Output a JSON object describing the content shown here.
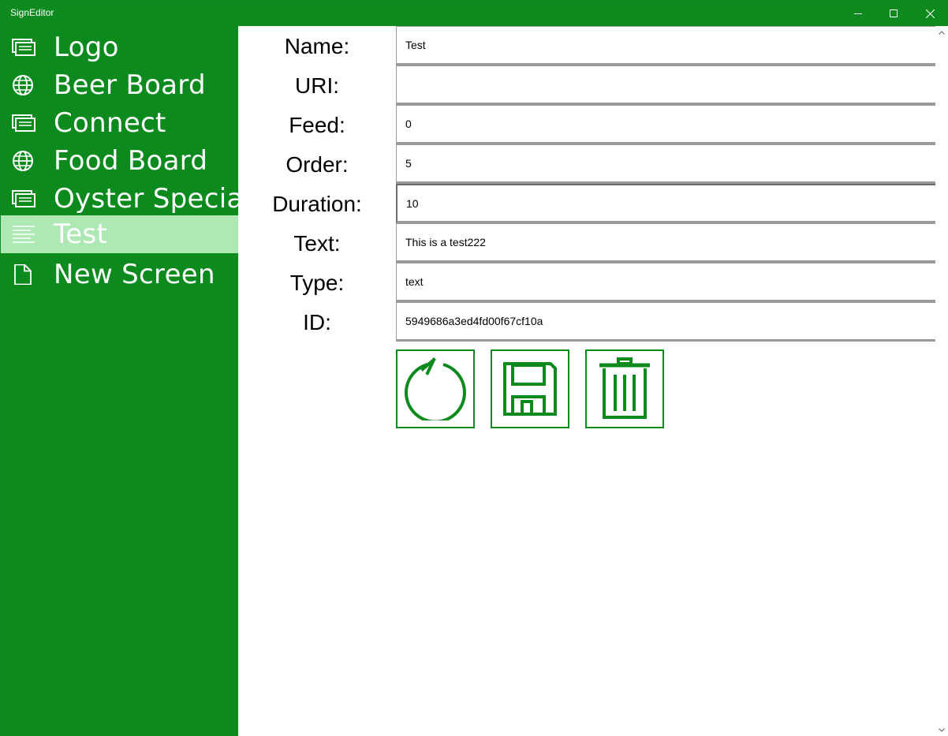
{
  "window": {
    "title": "SignEditor",
    "accent_color": "#0c8a1e",
    "selected_color": "#aee8b5"
  },
  "sidebar": {
    "items": [
      {
        "label": "Logo",
        "icon": "slides-icon",
        "selected": false
      },
      {
        "label": "Beer Board",
        "icon": "globe-icon",
        "selected": false
      },
      {
        "label": "Connect",
        "icon": "slides-icon",
        "selected": false
      },
      {
        "label": "Food Board",
        "icon": "globe-icon",
        "selected": false
      },
      {
        "label": "Oyster Special",
        "icon": "slides-icon",
        "selected": false
      },
      {
        "label": "Test",
        "icon": "text-lines-icon",
        "selected": true
      },
      {
        "label": "New Screen",
        "icon": "document-icon",
        "selected": false
      }
    ]
  },
  "form": {
    "name": {
      "label": "Name:",
      "value": "Test"
    },
    "uri": {
      "label": "URI:",
      "value": ""
    },
    "feed": {
      "label": "Feed:",
      "value": "0"
    },
    "order": {
      "label": "Order:",
      "value": "5"
    },
    "duration": {
      "label": "Duration:",
      "value": "10"
    },
    "text": {
      "label": "Text:",
      "value": "This is a test222"
    },
    "type": {
      "label": "Type:",
      "value": "text"
    },
    "id": {
      "label": "ID:",
      "value": "5949686a3ed4fd00f67cf10a"
    }
  },
  "actions": {
    "refresh_icon": "refresh-icon",
    "save_icon": "save-icon",
    "delete_icon": "trash-icon"
  }
}
